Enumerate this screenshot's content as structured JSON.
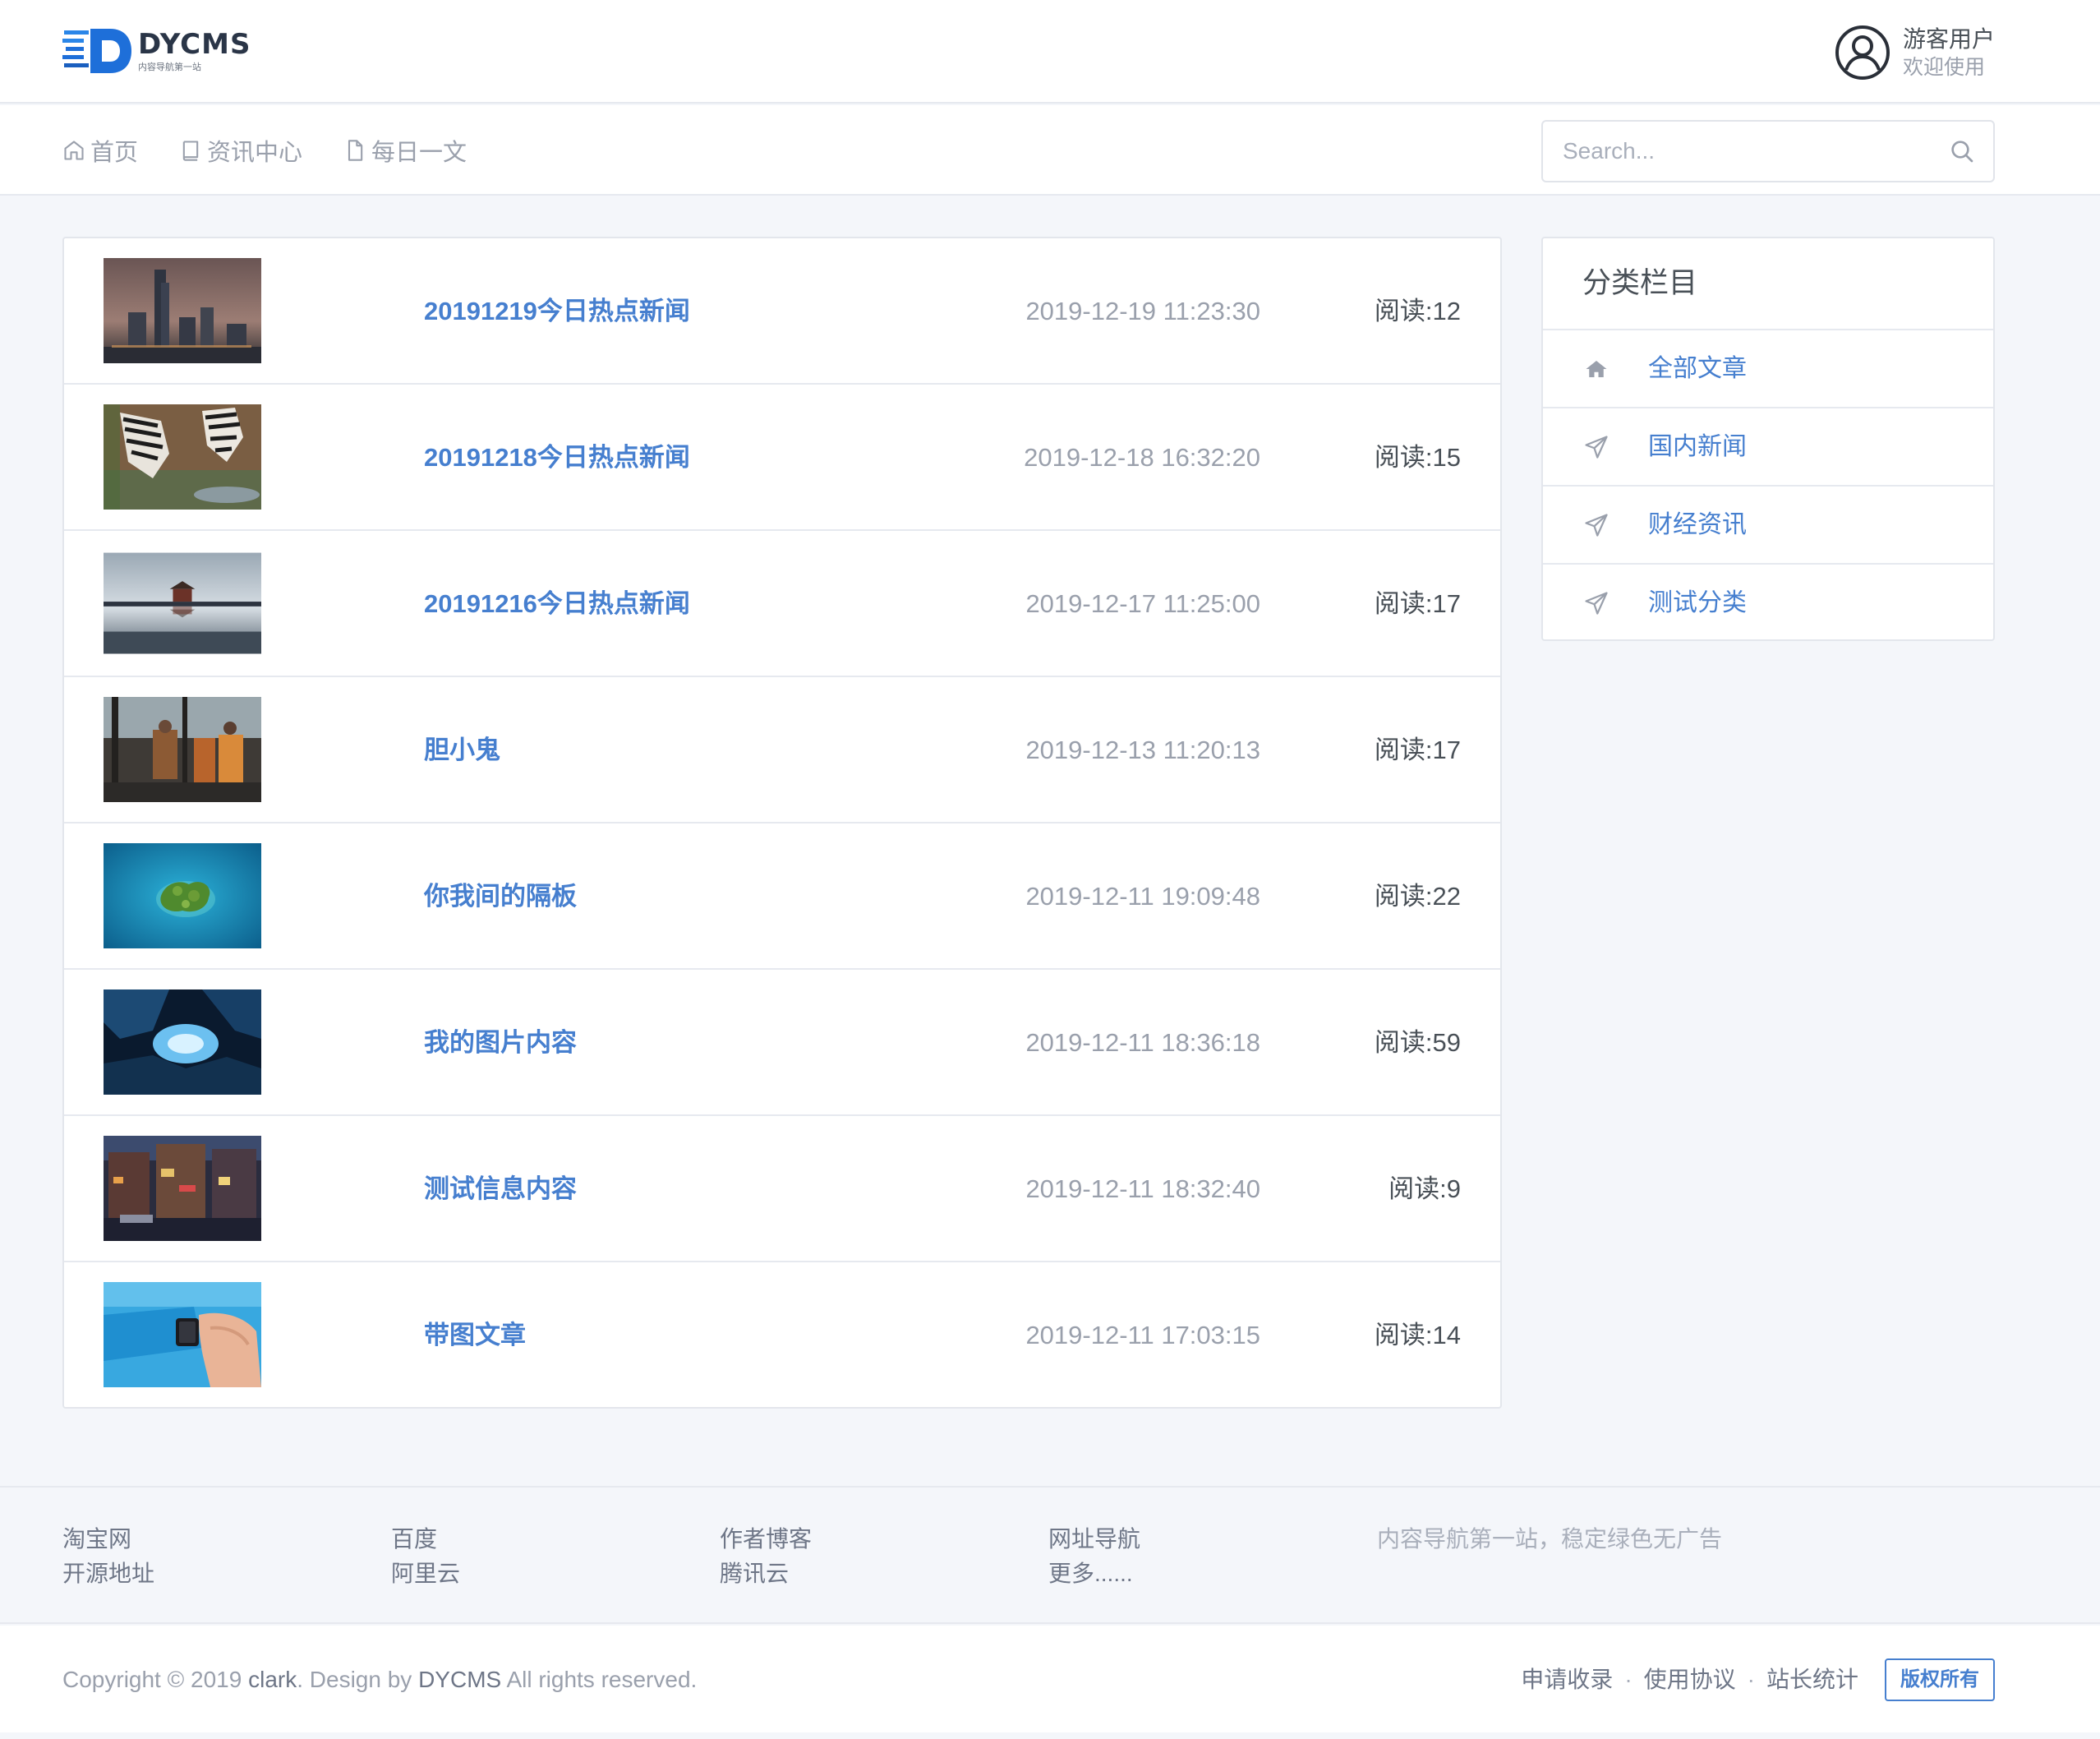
{
  "header": {
    "logo_title": "DYCMS",
    "logo_subtitle": "内容导航第一站",
    "user_name": "游客用户",
    "user_subtitle": "欢迎使用",
    "brand_color": "#1e6fd9"
  },
  "nav": {
    "items": [
      {
        "label": "首页",
        "icon": "home-icon"
      },
      {
        "label": "资讯中心",
        "icon": "book-icon"
      },
      {
        "label": "每日一文",
        "icon": "file-icon"
      }
    ],
    "search_placeholder": "Search..."
  },
  "articles": [
    {
      "title": "20191219今日热点新闻",
      "date": "2019-12-19 11:23:30",
      "reads": "阅读:12",
      "thumb": "city-skyline-night"
    },
    {
      "title": "20191218今日热点新闻",
      "date": "2019-12-18 16:32:20",
      "reads": "阅读:15",
      "thumb": "zebras-drinking"
    },
    {
      "title": "20191216今日热点新闻",
      "date": "2019-12-17 11:25:00",
      "reads": "阅读:17",
      "thumb": "palace-on-water"
    },
    {
      "title": "胆小鬼",
      "date": "2019-12-13 11:20:13",
      "reads": "阅读:17",
      "thumb": "airport-travelers"
    },
    {
      "title": "你我间的隔板",
      "date": "2019-12-11 19:09:48",
      "reads": "阅读:22",
      "thumb": "island-aerial"
    },
    {
      "title": "我的图片内容",
      "date": "2019-12-11 18:36:18",
      "reads": "阅读:59",
      "thumb": "ice-cave"
    },
    {
      "title": "测试信息内容",
      "date": "2019-12-11 18:32:40",
      "reads": "阅读:9",
      "thumb": "street-night"
    },
    {
      "title": "带图文章",
      "date": "2019-12-11 17:03:15",
      "reads": "阅读:14",
      "thumb": "smartwatch-wrist"
    }
  ],
  "sidebar": {
    "title": "分类栏目",
    "items": [
      {
        "label": "全部文章",
        "icon": "home-filled-icon"
      },
      {
        "label": "国内新闻",
        "icon": "send-icon"
      },
      {
        "label": "财经资讯",
        "icon": "send-icon"
      },
      {
        "label": "测试分类",
        "icon": "send-icon"
      }
    ]
  },
  "footer": {
    "columns": [
      [
        "淘宝网",
        "开源地址"
      ],
      [
        "百度",
        "阿里云"
      ],
      [
        "作者博客",
        "腾讯云"
      ],
      [
        "网址导航",
        "更多......"
      ]
    ],
    "tagline": "内容导航第一站，稳定绿色无广告",
    "copyright_prefix": "Copyright © 2019 ",
    "copyright_owner": "clark",
    "copyright_mid": ". Design by ",
    "copyright_brand": "DYCMS",
    "copyright_suffix": " All rights reserved.",
    "links": [
      "申请收录",
      "使用协议",
      "站长统计"
    ],
    "separator": "·",
    "rights_button": "版权所有"
  },
  "colors": {
    "accent": "#467fcf",
    "muted": "#9aa0ac",
    "text": "#495057",
    "background": "#f4f6fa"
  }
}
